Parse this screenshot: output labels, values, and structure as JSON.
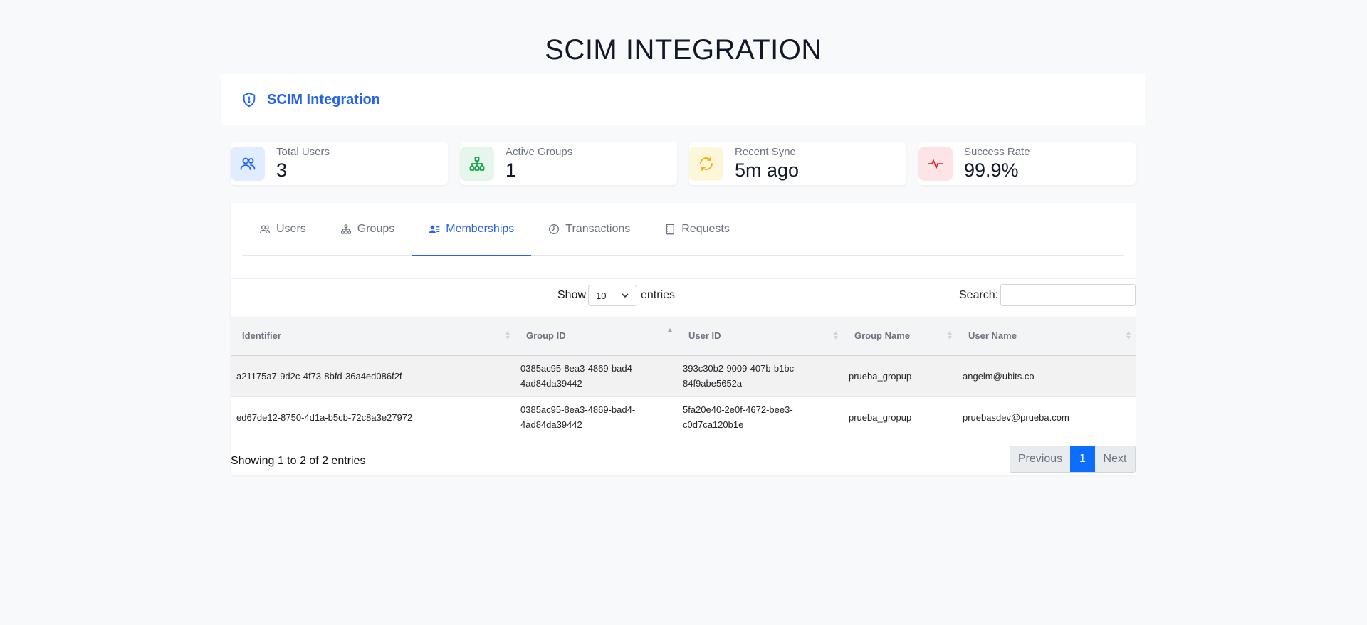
{
  "page": {
    "title": "SCIM INTEGRATION"
  },
  "header": {
    "title": "SCIM Integration",
    "icon": "shield-icon"
  },
  "stats": [
    {
      "label": "Total Users",
      "value": "3",
      "icon": "users-icon",
      "color": "#2563eb",
      "bg": "#e0ecff"
    },
    {
      "label": "Active Groups",
      "value": "1",
      "icon": "sitemap-icon",
      "color": "#16a34a",
      "bg": "#e6f6ec"
    },
    {
      "label": "Recent Sync",
      "value": "5m ago",
      "icon": "sync-icon",
      "color": "#eab308",
      "bg": "#fdf6d8"
    },
    {
      "label": "Success Rate",
      "value": "99.9%",
      "icon": "activity-icon",
      "color": "#dc2626",
      "bg": "#fde4e6"
    }
  ],
  "tabs": [
    {
      "label": "Users",
      "icon": "users-icon"
    },
    {
      "label": "Groups",
      "icon": "sitemap-icon"
    },
    {
      "label": "Memberships",
      "icon": "user-list-icon",
      "active": true
    },
    {
      "label": "Transactions",
      "icon": "clock-icon"
    },
    {
      "label": "Requests",
      "icon": "journal-icon"
    }
  ],
  "table_controls": {
    "show_label": "Show",
    "page_length": "10",
    "entries_label": "entries",
    "search_label": "Search:",
    "search_value": ""
  },
  "table": {
    "columns": [
      "Identifier",
      "Group ID",
      "User ID",
      "Group Name",
      "User Name"
    ],
    "sorted_column": "Group ID",
    "rows": [
      [
        "a21175a7-9d2c-4f73-8bfd-36a4ed086f2f",
        "0385ac95-8ea3-4869-bad4-4ad84da39442",
        "393c30b2-9009-407b-b1bc-84f9abe5652a",
        "prueba_gropup",
        "angelm@ubits.co"
      ],
      [
        "ed67de12-8750-4d1a-b5cb-72c8a3e27972",
        "0385ac95-8ea3-4869-bad4-4ad84da39442",
        "5fa20e40-2e0f-4672-bee3-c0d7ca120b1e",
        "prueba_gropup",
        "pruebasdev@prueba.com"
      ]
    ]
  },
  "footer": {
    "info": "Showing 1 to 2 of 2 entries",
    "previous": "Previous",
    "current_page": "1",
    "next": "Next"
  },
  "colors": {
    "accent": "#2563eb",
    "pager_active": "#0d6efd"
  }
}
